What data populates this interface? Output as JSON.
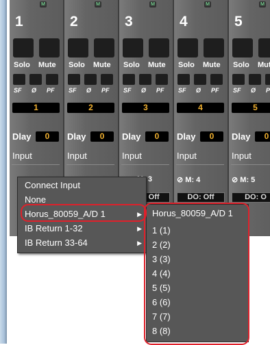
{
  "channels": [
    {
      "number": "1",
      "solo": "Solo",
      "mute": "Mute",
      "sf": "SF",
      "phase": "Ø",
      "pf": "PF",
      "display": "1",
      "delay_label": "Dlay",
      "delay_value": "0",
      "input_label": "Input"
    },
    {
      "number": "2",
      "solo": "Solo",
      "mute": "Mute",
      "sf": "SF",
      "phase": "Ø",
      "pf": "PF",
      "display": "2",
      "delay_label": "Dlay",
      "delay_value": "0",
      "input_label": "Input"
    },
    {
      "number": "3",
      "solo": "Solo",
      "mute": "Mute",
      "sf": "SF",
      "phase": "Ø",
      "pf": "PF",
      "display": "3",
      "delay_label": "Dlay",
      "delay_value": "0",
      "input_label": "Input",
      "meter": "M: 3"
    },
    {
      "number": "4",
      "solo": "Solo",
      "mute": "Mute",
      "sf": "SF",
      "phase": "Ø",
      "pf": "PF",
      "display": "4",
      "delay_label": "Dlay",
      "delay_value": "0",
      "input_label": "Input",
      "meter": "M: 4",
      "direct_out": "DO: Off"
    },
    {
      "number": "5",
      "solo": "Solo",
      "mute": "Mute",
      "sf": "SF",
      "phase": "Ø",
      "pf": "PF",
      "display": "5",
      "delay_label": "Dlay",
      "delay_value": "0",
      "input_label": "Input",
      "meter": "M: 5",
      "direct_out": "DO: O"
    }
  ],
  "strip_partial": {
    "direct_out_ch3": "DO: Off"
  },
  "context_menu": {
    "items": [
      "Connect Input",
      "None",
      "Horus_80059_A/D 1",
      "IB Return 1-32",
      "IB Return 33-64"
    ]
  },
  "submenu": {
    "header": "Horus_80059_A/D 1",
    "items": [
      "1 (1)",
      "2 (2)",
      "3 (3)",
      "4 (4)",
      "5 (5)",
      "6 (6)",
      "7 (7)",
      "8 (8)"
    ]
  },
  "colors": {
    "highlight": "#e0202a",
    "value_text": "#f0b030",
    "panel": "#575757"
  }
}
